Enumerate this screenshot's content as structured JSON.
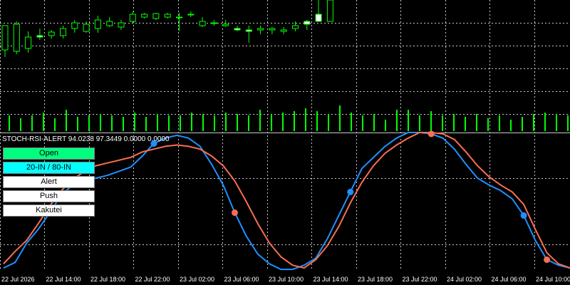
{
  "indicator": {
    "title": "STOCH-RSI-ALERT 94.0238 97.3449 0.0000 0.0000",
    "buttons": [
      {
        "label": "Open",
        "bg": "#00ff7f"
      },
      {
        "label": "20-IN / 80-IN",
        "bg": "#00ffff"
      },
      {
        "label": "Alert",
        "bg": "#ffffff"
      },
      {
        "label": "Push",
        "bg": "#ffffff"
      },
      {
        "label": "Kakutei",
        "bg": "#ffffff"
      }
    ]
  },
  "x_axis_labels": [
    "22 Jul 2026",
    "22 Jul 14:00",
    "22 Jul 18:00",
    "22 Jul 22:00",
    "23 Jul 02:00",
    "23 Jul 06:00",
    "23 Jul 10:00",
    "23 Jul 14:00",
    "23 Jul 18:00",
    "23 Jul 22:00",
    "24 Jul 02:00",
    "24 Jul 06:00",
    "24 Jul 10:00"
  ],
  "colors": {
    "background": "#000000",
    "grid": "#c8c8c8",
    "candle_bull": "#00ff00",
    "candle_bear_body": "#ffffff",
    "volume": "#00ff00",
    "stoch_k": "#1e90ff",
    "stoch_d": "#fa6e50",
    "signal_up": "#1e90ff",
    "signal_down": "#fa6e50"
  },
  "chart_data": {
    "type": "line",
    "x_count": 50,
    "candles": [
      {
        "o": 70,
        "h": 58,
        "l": 80,
        "c": 36
      },
      {
        "o": 72,
        "h": 30,
        "l": 76,
        "c": 34
      },
      {
        "o": 68,
        "h": 44,
        "l": 74,
        "c": 52
      },
      {
        "o": 50,
        "h": 40,
        "l": 56,
        "c": 52
      },
      {
        "o": 50,
        "h": 42,
        "l": 54,
        "c": 45
      },
      {
        "o": 50,
        "h": 36,
        "l": 54,
        "c": 40
      },
      {
        "o": 40,
        "h": 28,
        "l": 46,
        "c": 32
      },
      {
        "o": 44,
        "h": 30,
        "l": 46,
        "c": 34
      },
      {
        "o": 40,
        "h": 22,
        "l": 46,
        "c": 28
      },
      {
        "o": 36,
        "h": 24,
        "l": 38,
        "c": 30
      },
      {
        "o": 38,
        "h": 28,
        "l": 42,
        "c": 32
      },
      {
        "o": 30,
        "h": 16,
        "l": 32,
        "c": 20
      },
      {
        "o": 24,
        "h": 18,
        "l": 26,
        "c": 20
      },
      {
        "o": 26,
        "h": 18,
        "l": 28,
        "c": 19
      },
      {
        "o": 24,
        "h": 18,
        "l": 26,
        "c": 20
      },
      {
        "o": 24,
        "h": 18,
        "l": 44,
        "c": 24
      },
      {
        "o": 20,
        "h": 16,
        "l": 24,
        "c": 20
      },
      {
        "o": 36,
        "h": 24,
        "l": 38,
        "c": 30
      },
      {
        "o": 32,
        "h": 28,
        "l": 36,
        "c": 32
      },
      {
        "o": 36,
        "h": 28,
        "l": 38,
        "c": 34
      },
      {
        "o": 40,
        "h": 36,
        "l": 44,
        "c": 42
      },
      {
        "o": 42,
        "h": 36,
        "l": 60,
        "c": 44
      },
      {
        "o": 42,
        "h": 36,
        "l": 48,
        "c": 40
      },
      {
        "o": 42,
        "h": 38,
        "l": 48,
        "c": 40
      },
      {
        "o": 44,
        "h": 38,
        "l": 48,
        "c": 42
      },
      {
        "o": 40,
        "h": 30,
        "l": 44,
        "c": 36
      },
      {
        "o": 30,
        "h": 28,
        "l": 42,
        "c": 34
      },
      {
        "o": 20,
        "h": 0,
        "l": 30,
        "c": 30
      },
      {
        "o": 30,
        "h": 0,
        "l": 30,
        "c": 0
      }
    ],
    "volume": [
      22,
      18,
      22,
      26,
      18,
      30,
      20,
      22,
      24,
      22,
      20,
      26,
      20,
      24,
      22,
      22,
      26,
      24,
      22,
      26,
      24,
      22,
      30,
      24,
      26,
      28,
      32,
      28,
      24,
      36,
      26,
      22,
      24,
      16,
      30,
      30,
      22,
      28,
      22,
      24,
      20,
      24,
      18,
      22,
      16,
      20,
      24,
      26,
      24,
      22
    ],
    "series": [
      {
        "values": [
          2,
          6,
          20,
          30,
          42,
          55,
          62,
          65,
          67,
          69,
          72,
          75,
          83,
          92,
          96,
          98,
          96,
          90,
          77,
          62,
          42,
          25,
          12,
          5,
          1,
          1,
          4,
          9,
          23,
          40,
          57,
          74,
          82,
          90,
          96,
          100,
          100,
          99,
          96,
          88,
          77,
          67,
          62,
          58,
          52,
          40,
          22,
          8,
          4,
          2
        ]
      },
      {
        "values": [
          5,
          14,
          22,
          34,
          47,
          58,
          66,
          72,
          76,
          78,
          80,
          82,
          86,
          88,
          90,
          91,
          90,
          88,
          83,
          76,
          65,
          50,
          34,
          20,
          10,
          4,
          2,
          8,
          18,
          32,
          49,
          64,
          76,
          85,
          91,
          96,
          100,
          100,
          99,
          95,
          86,
          76,
          68,
          62,
          57,
          48,
          30,
          13,
          5,
          2
        ]
      }
    ],
    "signals": [
      {
        "i": 13,
        "type": "up"
      },
      {
        "i": 20,
        "type": "down"
      },
      {
        "i": 30,
        "type": "up"
      },
      {
        "i": 37,
        "type": "down"
      },
      {
        "i": 45,
        "type": "up"
      },
      {
        "i": 47,
        "type": "down"
      }
    ]
  }
}
